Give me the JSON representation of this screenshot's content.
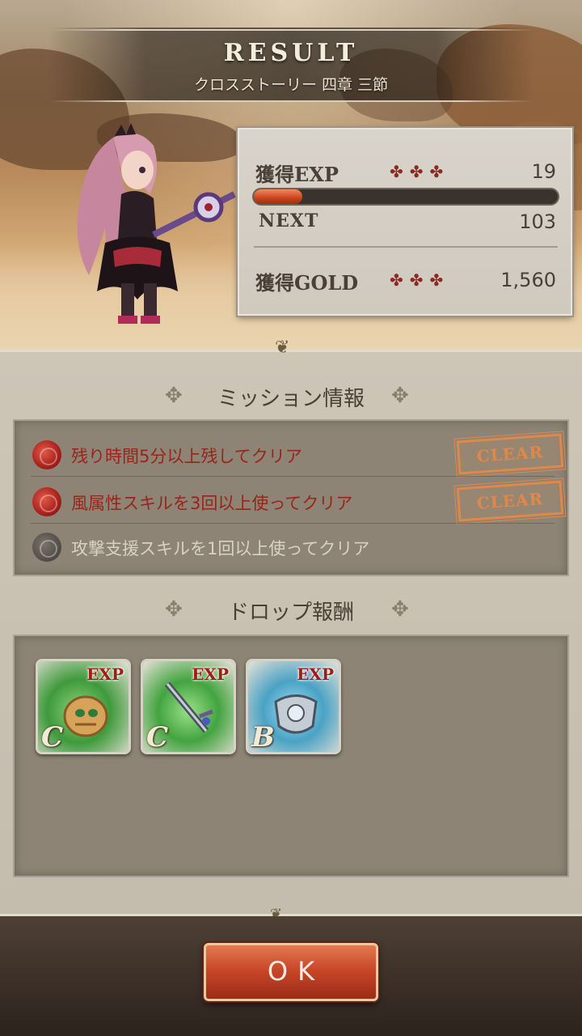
{
  "header": {
    "title": "RESULT",
    "subtitle": "クロスストーリー 四章 三節"
  },
  "stats": {
    "exp_label": "獲得EXP",
    "exp_value": "19",
    "exp_stars": "✤✤✤",
    "exp_progress": 0.16,
    "next_label": "NEXT",
    "next_value": "103",
    "gold_label": "獲得GOLD",
    "gold_value": "1,560",
    "gold_stars": "✤✤✤"
  },
  "missions": {
    "title": "ミッション情報",
    "items": [
      {
        "text": "残り時間5分以上残してクリア",
        "cleared": true,
        "badge": "CLEAR",
        "icon": "rose-icon"
      },
      {
        "text": "風属性スキルを3回以上使ってクリア",
        "cleared": true,
        "badge": "CLEAR",
        "icon": "rose-icon"
      },
      {
        "text": "攻撃支援スキルを1回以上使ってクリア",
        "cleared": false,
        "icon": "rose-icon"
      }
    ]
  },
  "drops": {
    "title": "ドロップ報酬",
    "items": [
      {
        "tag": "EXP",
        "rank": "C",
        "icon": "shield-icon",
        "color": "#4fa84a"
      },
      {
        "tag": "EXP",
        "rank": "C",
        "icon": "sword-icon",
        "color": "#58b04c"
      },
      {
        "tag": "EXP",
        "rank": "B",
        "icon": "armor-icon",
        "color": "#5aa6c4"
      }
    ]
  },
  "ok_button": {
    "label": "OK"
  },
  "colors": {
    "accent": "#c9472a",
    "clear_stamp": "#e0884a",
    "mission_text_active": "#9a2418"
  }
}
